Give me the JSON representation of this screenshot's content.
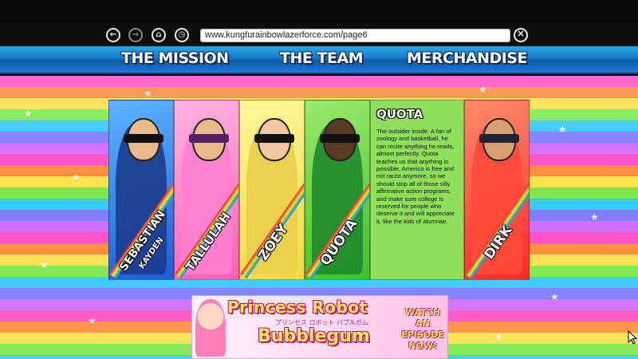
{
  "browser": {
    "url": "www.kungfurainbowlazerforce.com/page6",
    "back_glyph": "←",
    "forward_glyph": "→",
    "home_glyph": "⌂",
    "history_glyph": "◷",
    "close_glyph": "✕",
    "icons": [
      "back-arrow-icon",
      "forward-arrow-icon",
      "home-icon",
      "history-clock-icon",
      "close-icon"
    ]
  },
  "site_nav": {
    "items": [
      "THE MISSION",
      "THE TEAM",
      "MERCHANDISE"
    ]
  },
  "team": {
    "members": [
      {
        "name": "SEBASTIAN",
        "sub": "KAYDEN"
      },
      {
        "name": "TALLULAH",
        "sub": ""
      },
      {
        "name": "ZOEY",
        "sub": ""
      },
      {
        "name": "QUOTA",
        "sub": ""
      },
      {
        "name": "DIRK",
        "sub": ""
      }
    ],
    "selected": {
      "title": "QUOTA",
      "bio": "The outsider inside. A fan of zoology and basketball, he can recite anything he reads, almost perfectly. Quota teaches us that anything is possible, America is free and not racist anymore, so we should stop all of those silly affirmative action programs, and make sure college is reserved for people who deserve it and will appreciate it, like the kids of alumnae."
    }
  },
  "ad_banner": {
    "title_line1": "Princess Robot",
    "title_japanese": "プリンセス ロボット バブルガム",
    "title_line2": "Bubblegum",
    "cta": "WATCH AN EPISODE NOW!"
  },
  "colors": {
    "nav_bar": "#1779c6",
    "info_panel": "#8ee05a",
    "banner_text": "#ffe95a",
    "banner_outline": "#c2187a"
  },
  "star_glyph": "★"
}
